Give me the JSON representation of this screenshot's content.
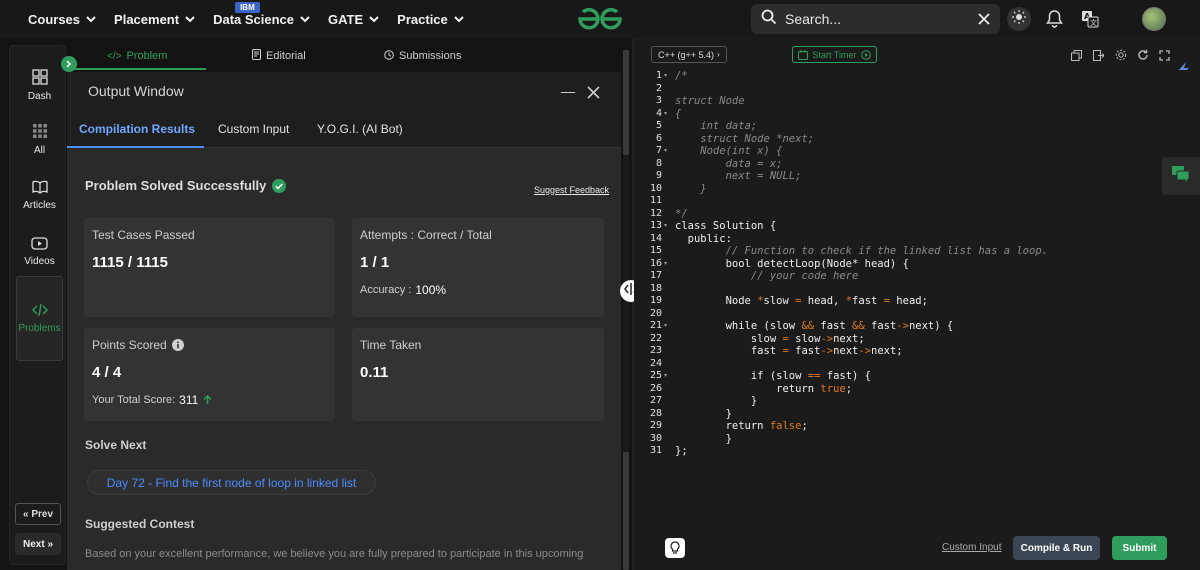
{
  "topnav": {
    "items": [
      {
        "label": "Courses"
      },
      {
        "label": "Placement"
      },
      {
        "label": "Data Science",
        "badge": "IBM"
      },
      {
        "label": "GATE"
      },
      {
        "label": "Practice"
      }
    ],
    "search_placeholder": "Search...",
    "accent": "#2f9e5c"
  },
  "sidebar": {
    "items": [
      {
        "label": "Dash",
        "icon": "dashboard-icon"
      },
      {
        "label": "All",
        "icon": "grid-icon"
      },
      {
        "label": "Articles",
        "icon": "book-icon"
      },
      {
        "label": "Videos",
        "icon": "video-icon"
      },
      {
        "label": "Problems",
        "icon": "code-icon"
      }
    ],
    "prev": "Prev",
    "next": "Next"
  },
  "problem_tabs": [
    {
      "label": "Problem",
      "icon": "code-icon"
    },
    {
      "label": "Editorial",
      "icon": "document-icon"
    },
    {
      "label": "Submissions",
      "icon": "clock-icon"
    }
  ],
  "output_window": {
    "title": "Output Window",
    "tabs": [
      "Compilation Results",
      "Custom Input",
      "Y.O.G.I. (AI Bot)"
    ],
    "status": "Problem Solved Successfully",
    "feedback_link": "Suggest Feedback",
    "cards": {
      "test_cases": {
        "title": "Test Cases Passed",
        "value": "1115 / 1115"
      },
      "attempts": {
        "title": "Attempts : Correct / Total",
        "value": "1 / 1",
        "sub_label": "Accuracy :",
        "sub_value": "100%"
      },
      "points": {
        "title": "Points Scored",
        "value": "4 / 4",
        "sub_label": "Your Total Score:",
        "sub_value": "311"
      },
      "time": {
        "title": "Time Taken",
        "value": "0.11"
      }
    },
    "solve_next_heading": "Solve Next",
    "solve_next_item": "Day 72 - Find the first node of loop in linked list",
    "contest_heading": "Suggested Contest",
    "contest_text": "Based on your excellent performance, we believe you are fully prepared to participate in this upcoming"
  },
  "editor": {
    "language": "C++ (g++ 5.4)",
    "timer": "Start Timer",
    "line_numbers": [
      "1",
      "2",
      "3",
      "4",
      "5",
      "6",
      "7",
      "8",
      "9",
      "10",
      "11",
      "12",
      "13",
      "14",
      "15",
      "16",
      "17",
      "18",
      "19",
      "20",
      "21",
      "22",
      "23",
      "24",
      "25",
      "26",
      "27",
      "28",
      "29",
      "30",
      "31"
    ],
    "custom_input": "Custom Input",
    "compile_run": "Compile & Run",
    "submit": "Submit"
  }
}
